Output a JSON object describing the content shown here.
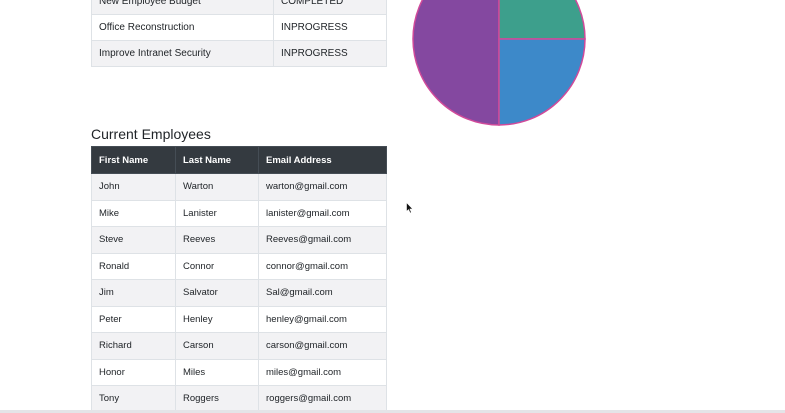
{
  "projects": {
    "rows": [
      {
        "name": "New Employee Budget",
        "status": "COMPLETED"
      },
      {
        "name": "Office Reconstruction",
        "status": "INPROGRESS"
      },
      {
        "name": "Improve Intranet Security",
        "status": "INPROGRESS"
      }
    ]
  },
  "pie": {
    "slices": [
      {
        "color": "#8448a0",
        "fraction": 0.5
      },
      {
        "color": "#3d9f8c",
        "fraction": 0.25
      },
      {
        "color": "#3d89c9",
        "fraction": 0.25
      }
    ],
    "stroke_color": "#d04a9a"
  },
  "employees": {
    "title": "Current Employees",
    "columns": [
      "First Name",
      "Last Name",
      "Email Address"
    ],
    "rows": [
      [
        "John",
        "Warton",
        "warton@gmail.com"
      ],
      [
        "Mike",
        "Lanister",
        "lanister@gmail.com"
      ],
      [
        "Steve",
        "Reeves",
        "Reeves@gmail.com"
      ],
      [
        "Ronald",
        "Connor",
        "connor@gmail.com"
      ],
      [
        "Jim",
        "Salvator",
        "Sal@gmail.com"
      ],
      [
        "Peter",
        "Henley",
        "henley@gmail.com"
      ],
      [
        "Richard",
        "Carson",
        "carson@gmail.com"
      ],
      [
        "Honor",
        "Miles",
        "miles@gmail.com"
      ],
      [
        "Tony",
        "Roggers",
        "roggers@gmail.com"
      ]
    ]
  }
}
